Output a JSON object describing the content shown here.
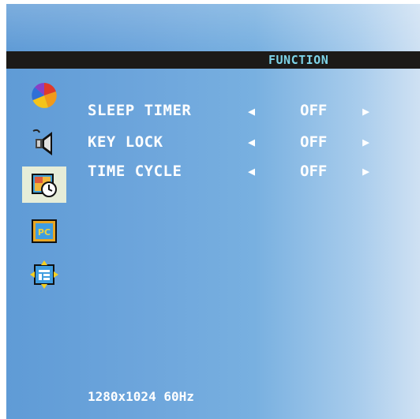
{
  "header": {
    "title": "FUNCTION"
  },
  "sidebar": {
    "items": [
      {
        "icon": "color-wheel-icon"
      },
      {
        "icon": "speaker-icon"
      },
      {
        "icon": "clock-function-icon",
        "selected": true
      },
      {
        "icon": "pc-icon"
      },
      {
        "icon": "position-icon"
      }
    ]
  },
  "menu": {
    "items": [
      {
        "label": "SLEEP TIMER",
        "value": "OFF"
      },
      {
        "label": "KEY LOCK",
        "value": "OFF"
      },
      {
        "label": "TIME CYCLE",
        "value": "OFF"
      }
    ],
    "arrow_left": "◀",
    "arrow_right": "▶"
  },
  "status": {
    "resolution": "1280x1024 60Hz"
  },
  "colors": {
    "title": "#7dd3e8",
    "bar": "#1c1a18",
    "selected_bg": "#e6edd8"
  }
}
